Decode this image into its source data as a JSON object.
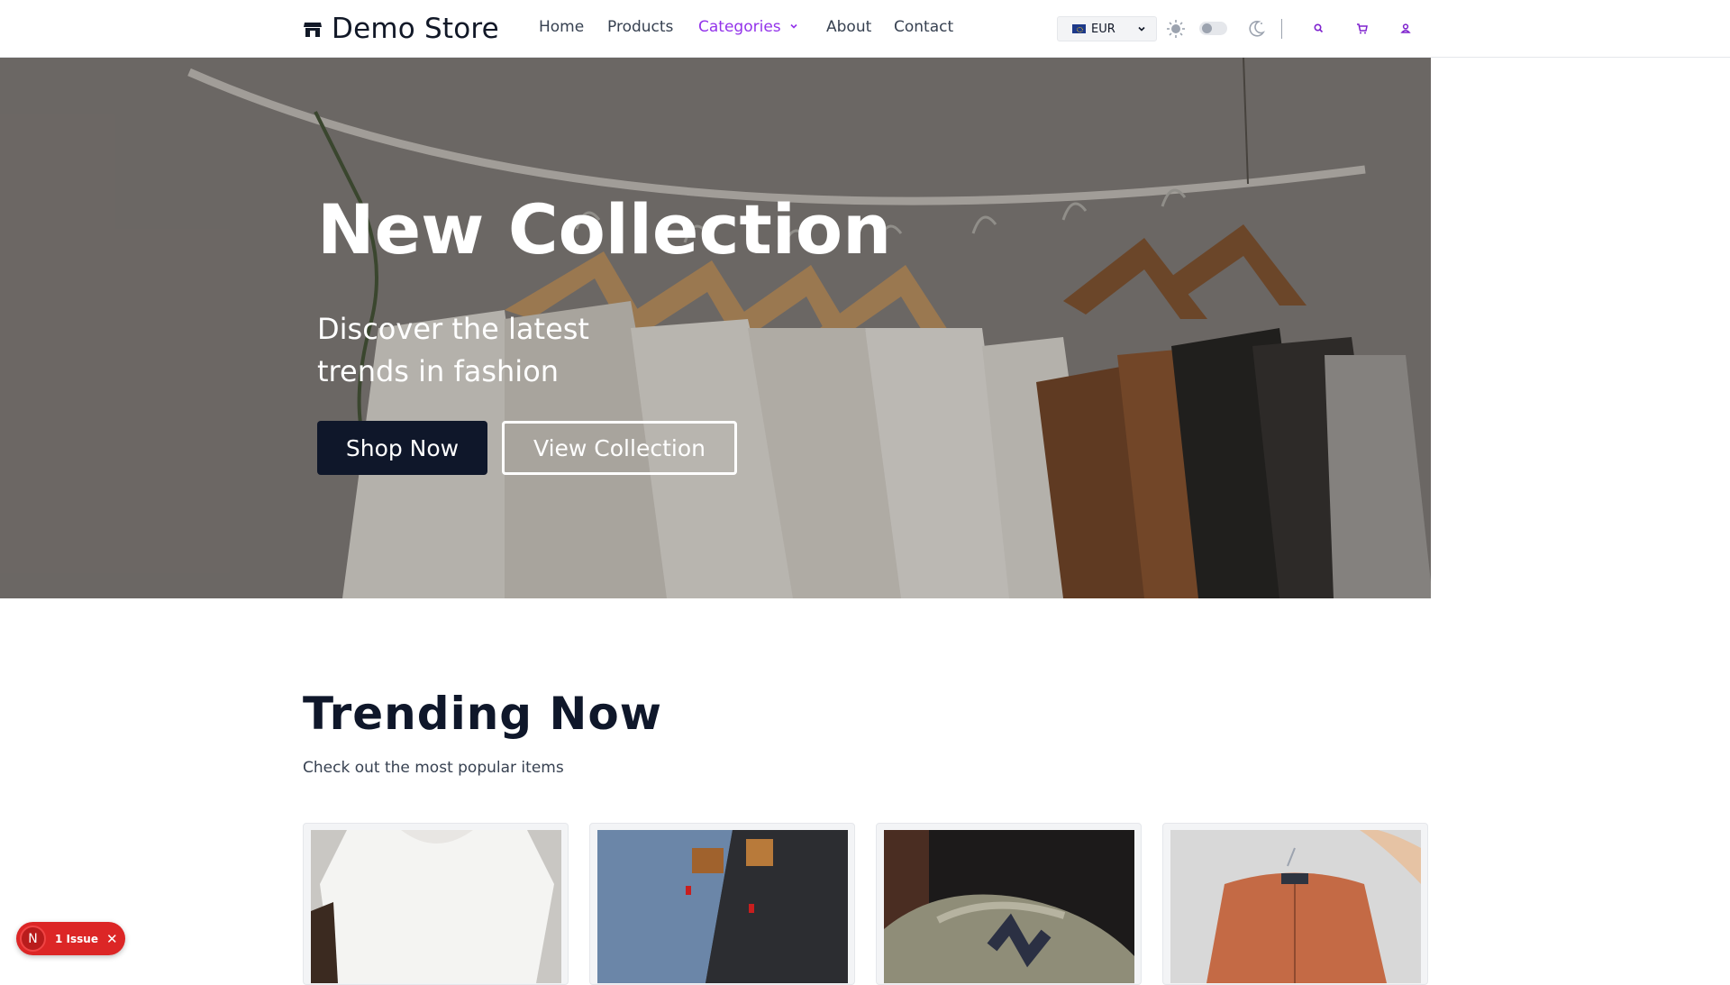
{
  "header": {
    "brand": "Demo Store",
    "nav": [
      {
        "label": "Home"
      },
      {
        "label": "Products"
      },
      {
        "label": "Categories"
      },
      {
        "label": "About"
      },
      {
        "label": "Contact"
      }
    ],
    "currency": "EUR",
    "theme_dark_enabled": false,
    "icons": [
      "store-icon",
      "chevron-down-icon",
      "sun-icon",
      "moon-icon",
      "search-icon",
      "cart-icon",
      "user-icon"
    ],
    "accent_color": "#9333ea"
  },
  "hero": {
    "title": "New Collection",
    "subtitle": "Discover the latest trends in fashion",
    "primary_button": "Shop Now",
    "secondary_button": "View Collection"
  },
  "trending": {
    "title": "Trending Now",
    "subtitle": "Check out the most popular items",
    "products": [
      {
        "image": "white-tshirt"
      },
      {
        "image": "denim-jeans"
      },
      {
        "image": "sneakers"
      },
      {
        "image": "orange-jacket"
      }
    ]
  },
  "issue_badge": {
    "avatar": "N",
    "label": "1 Issue",
    "color": "#dc2626"
  }
}
